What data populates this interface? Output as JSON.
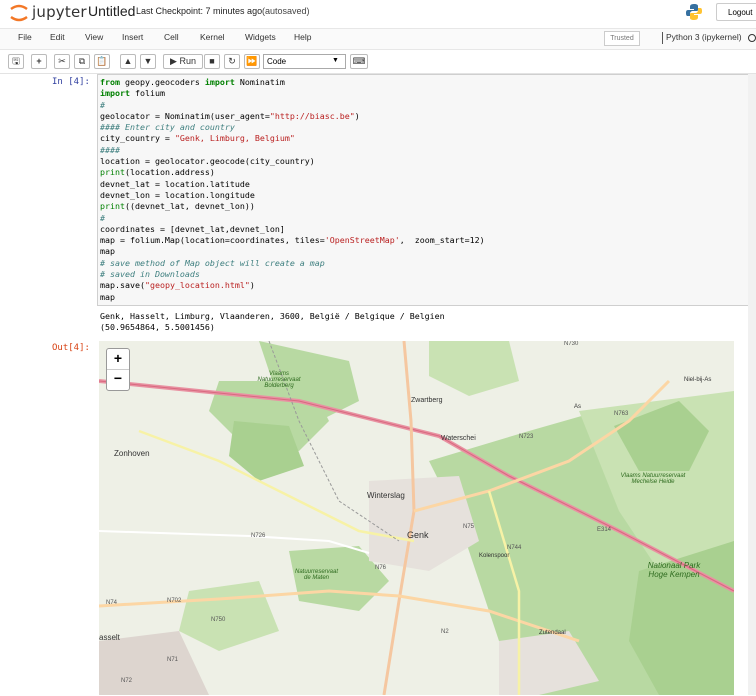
{
  "app": {
    "logo_text": "jupyter",
    "notebook_name": "Untitled",
    "checkpoint": "Last Checkpoint: 7 minutes ago",
    "autosaved": "(autosaved)",
    "logout_label": "Logout"
  },
  "menu": {
    "items": [
      "File",
      "Edit",
      "View",
      "Insert",
      "Cell",
      "Kernel",
      "Widgets",
      "Help"
    ],
    "trusted": "Trusted",
    "kernel_name": "Python 3 (ipykernel)"
  },
  "toolbar": {
    "run_label": "Run",
    "cell_type": "Code",
    "buttons": [
      "save-icon",
      "add-icon",
      "cut-icon",
      "copy-icon",
      "paste-icon",
      "up-arrow-icon",
      "down-arrow-icon",
      "run-icon",
      "stop-icon",
      "restart-icon",
      "fast-forward-icon",
      "keyboard-icon"
    ]
  },
  "cell": {
    "in_prompt": "In [4]:",
    "out_prompt": "Out[4]:",
    "code_lines": [
      [
        [
          "kw",
          "from"
        ],
        [
          "t",
          " geopy.geocoders "
        ],
        [
          "kw",
          "import"
        ],
        [
          "t",
          " Nominatim"
        ]
      ],
      [
        [
          "kw",
          "import"
        ],
        [
          "t",
          " folium"
        ]
      ],
      [
        [
          "cm",
          "#"
        ]
      ],
      [
        [
          "t",
          "geolocator = Nominatim(user_agent="
        ],
        [
          "st",
          "\"http://biasc.be\""
        ],
        [
          "t",
          ")"
        ]
      ],
      [
        [
          "cm",
          "#### Enter city and country"
        ]
      ],
      [
        [
          "t",
          "city_country = "
        ],
        [
          "st",
          "\"Genk, Limburg, Belgium\""
        ]
      ],
      [
        [
          "cm",
          "####"
        ]
      ],
      [
        [
          "t",
          "location = geolocator.geocode(city_country)"
        ]
      ],
      [
        [
          "bi",
          "print"
        ],
        [
          "t",
          "(location.address)"
        ]
      ],
      [
        [
          "t",
          "devnet_lat = location.latitude"
        ]
      ],
      [
        [
          "t",
          "devnet_lon = location.longitude"
        ]
      ],
      [
        [
          "bi",
          "print"
        ],
        [
          "t",
          "((devnet_lat, devnet_lon))"
        ]
      ],
      [
        [
          "cm",
          "#"
        ]
      ],
      [
        [
          "t",
          "coordinates = [devnet_lat,devnet_lon]"
        ]
      ],
      [
        [
          "t",
          "map = folium.Map(location=coordinates, tiles="
        ],
        [
          "st",
          "'OpenStreetMap'"
        ],
        [
          "t",
          ",  zoom_start=12)"
        ]
      ],
      [
        [
          "t",
          "map"
        ]
      ],
      [
        [
          "cm",
          "# save method of Map object will create a map"
        ]
      ],
      [
        [
          "cm",
          "# saved in Downloads"
        ]
      ],
      [
        [
          "t",
          "map.save("
        ],
        [
          "st",
          "\"geopy_location.html\""
        ],
        [
          "t",
          ")"
        ]
      ],
      [
        [
          "t",
          "map"
        ]
      ]
    ],
    "stdout": [
      "Genk, Hasselt, Limburg, Vlaanderen, 3600, België / Belgique / Belgien",
      "(50.9654864, 5.5001456)"
    ]
  },
  "map": {
    "zoom_in": "+",
    "zoom_out": "−",
    "labels": [
      "Zonhoven",
      "Zwartberg",
      "Waterschei",
      "Winterslag",
      "Genk",
      "Niel-bij-As",
      "As",
      "Zutendaal",
      "Kolenspoor",
      "Nationaal Park Hoge Kempen",
      "Vlaams Natuurreservaat Bolderberg",
      "Vlaams Natuurreservaat Mechelse Heide",
      "Natuurreservaat de Maten",
      "asselt"
    ],
    "road_labels": [
      "N730",
      "N763",
      "N723",
      "N726",
      "N75",
      "N744",
      "E314",
      "N76",
      "N74",
      "N702",
      "N750",
      "N2",
      "N71",
      "N72"
    ]
  },
  "colors": {
    "accent": "#303f9f",
    "out": "#d84315",
    "forest": "#b8d9a2",
    "park": "#c9e2b3",
    "motorway": "#e892a2"
  }
}
